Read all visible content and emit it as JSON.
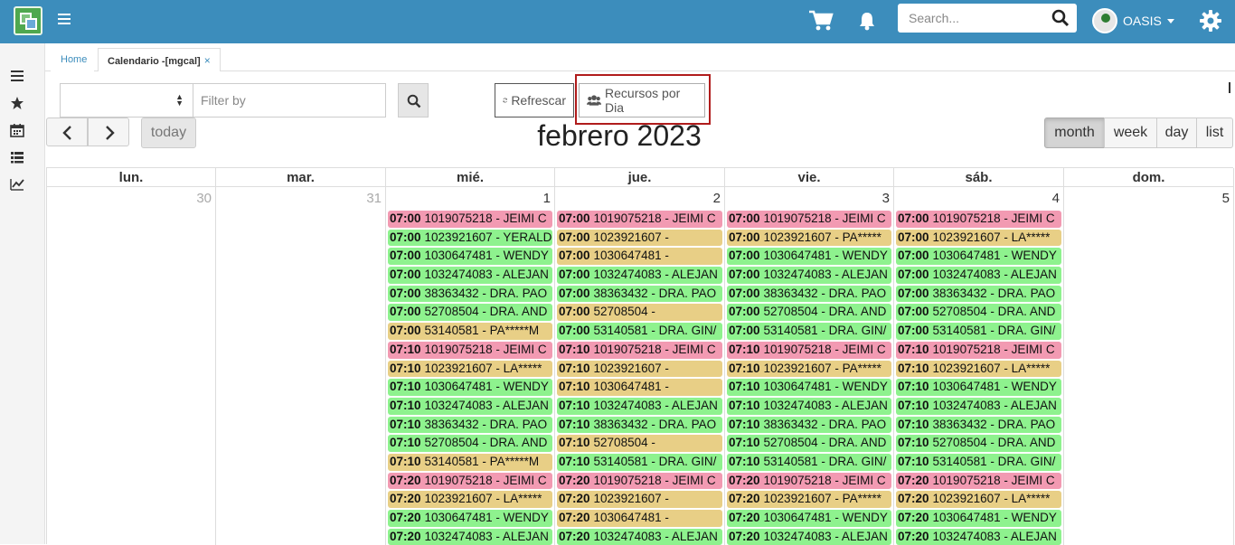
{
  "header": {
    "search_placeholder": "Search...",
    "user_name": "OASIS"
  },
  "tabs": [
    {
      "label": "Home"
    },
    {
      "label": "Calendario -[mgcal]",
      "close": "×"
    }
  ],
  "toolbar": {
    "filter_placeholder": "Filter by",
    "refresh_label": "Refrescar",
    "recursos_label": "Recursos por Dia"
  },
  "calendar": {
    "title": "febrero 2023",
    "today_label": "today",
    "views": [
      "month",
      "week",
      "day",
      "list"
    ],
    "active_view": "month",
    "weekdays": [
      "lun.",
      "mar.",
      "mié.",
      "jue.",
      "vie.",
      "sáb.",
      "dom."
    ],
    "day_numbers": [
      "30",
      "31",
      "1",
      "2",
      "3",
      "4",
      "5"
    ],
    "columns": [
      {
        "events": []
      },
      {
        "events": []
      },
      {
        "events": [
          {
            "time": "07:00",
            "text": "1019075218 - JEIMI C",
            "color": "pink"
          },
          {
            "time": "07:00",
            "text": "1023921607 - YERALD",
            "color": "green"
          },
          {
            "time": "07:00",
            "text": "1030647481 - WENDY",
            "color": "green"
          },
          {
            "time": "07:00",
            "text": "1032474083 - ALEJAN",
            "color": "green"
          },
          {
            "time": "07:00",
            "text": "38363432 - DRA. PAO",
            "color": "green"
          },
          {
            "time": "07:00",
            "text": "52708504 - DRA. AND",
            "color": "green"
          },
          {
            "time": "07:00",
            "text": "53140581 - PA*****M",
            "color": "yellow"
          },
          {
            "time": "07:10",
            "text": "1019075218 - JEIMI C",
            "color": "pink"
          },
          {
            "time": "07:10",
            "text": "1023921607 - LA*****",
            "color": "yellow"
          },
          {
            "time": "07:10",
            "text": "1030647481 - WENDY",
            "color": "green"
          },
          {
            "time": "07:10",
            "text": "1032474083 - ALEJAN",
            "color": "green"
          },
          {
            "time": "07:10",
            "text": "38363432 - DRA. PAO",
            "color": "green"
          },
          {
            "time": "07:10",
            "text": "52708504 - DRA. AND",
            "color": "green"
          },
          {
            "time": "07:10",
            "text": "53140581 - PA*****M",
            "color": "yellow"
          },
          {
            "time": "07:20",
            "text": "1019075218 - JEIMI C",
            "color": "pink"
          },
          {
            "time": "07:20",
            "text": "1023921607 - LA*****",
            "color": "yellow"
          },
          {
            "time": "07:20",
            "text": "1030647481 - WENDY",
            "color": "green"
          },
          {
            "time": "07:20",
            "text": "1032474083 - ALEJAN",
            "color": "green"
          }
        ]
      },
      {
        "events": [
          {
            "time": "07:00",
            "text": "1019075218 - JEIMI C",
            "color": "pink"
          },
          {
            "time": "07:00",
            "text": "1023921607 -",
            "color": "yellow"
          },
          {
            "time": "07:00",
            "text": "1030647481 -",
            "color": "yellow"
          },
          {
            "time": "07:00",
            "text": "1032474083 - ALEJAN",
            "color": "green"
          },
          {
            "time": "07:00",
            "text": "38363432 - DRA. PAO",
            "color": "green"
          },
          {
            "time": "07:00",
            "text": "52708504 -",
            "color": "yellow"
          },
          {
            "time": "07:00",
            "text": "53140581 - DRA. GIN/",
            "color": "green"
          },
          {
            "time": "07:10",
            "text": "1019075218 - JEIMI C",
            "color": "pink"
          },
          {
            "time": "07:10",
            "text": "1023921607 -",
            "color": "yellow"
          },
          {
            "time": "07:10",
            "text": "1030647481 -",
            "color": "yellow"
          },
          {
            "time": "07:10",
            "text": "1032474083 - ALEJAN",
            "color": "green"
          },
          {
            "time": "07:10",
            "text": "38363432 - DRA. PAO",
            "color": "green"
          },
          {
            "time": "07:10",
            "text": "52708504 -",
            "color": "yellow"
          },
          {
            "time": "07:10",
            "text": "53140581 - DRA. GIN/",
            "color": "green"
          },
          {
            "time": "07:20",
            "text": "1019075218 - JEIMI C",
            "color": "pink"
          },
          {
            "time": "07:20",
            "text": "1023921607 -",
            "color": "yellow"
          },
          {
            "time": "07:20",
            "text": "1030647481 -",
            "color": "yellow"
          },
          {
            "time": "07:20",
            "text": "1032474083 - ALEJAN",
            "color": "green"
          }
        ]
      },
      {
        "events": [
          {
            "time": "07:00",
            "text": "1019075218 - JEIMI C",
            "color": "pink"
          },
          {
            "time": "07:00",
            "text": "1023921607 - PA*****",
            "color": "yellow"
          },
          {
            "time": "07:00",
            "text": "1030647481 - WENDY",
            "color": "green"
          },
          {
            "time": "07:00",
            "text": "1032474083 - ALEJAN",
            "color": "green"
          },
          {
            "time": "07:00",
            "text": "38363432 - DRA. PAO",
            "color": "green"
          },
          {
            "time": "07:00",
            "text": "52708504 - DRA. AND",
            "color": "green"
          },
          {
            "time": "07:00",
            "text": "53140581 - DRA. GIN/",
            "color": "green"
          },
          {
            "time": "07:10",
            "text": "1019075218 - JEIMI C",
            "color": "pink"
          },
          {
            "time": "07:10",
            "text": "1023921607 - PA*****",
            "color": "yellow"
          },
          {
            "time": "07:10",
            "text": "1030647481 - WENDY",
            "color": "green"
          },
          {
            "time": "07:10",
            "text": "1032474083 - ALEJAN",
            "color": "green"
          },
          {
            "time": "07:10",
            "text": "38363432 - DRA. PAO",
            "color": "green"
          },
          {
            "time": "07:10",
            "text": "52708504 - DRA. AND",
            "color": "green"
          },
          {
            "time": "07:10",
            "text": "53140581 - DRA. GIN/",
            "color": "green"
          },
          {
            "time": "07:20",
            "text": "1019075218 - JEIMI C",
            "color": "pink"
          },
          {
            "time": "07:20",
            "text": "1023921607 - PA*****",
            "color": "yellow"
          },
          {
            "time": "07:20",
            "text": "1030647481 - WENDY",
            "color": "green"
          },
          {
            "time": "07:20",
            "text": "1032474083 - ALEJAN",
            "color": "green"
          }
        ]
      },
      {
        "events": [
          {
            "time": "07:00",
            "text": "1019075218 - JEIMI C",
            "color": "pink"
          },
          {
            "time": "07:00",
            "text": "1023921607 - LA*****",
            "color": "yellow"
          },
          {
            "time": "07:00",
            "text": "1030647481 - WENDY",
            "color": "green"
          },
          {
            "time": "07:00",
            "text": "1032474083 - ALEJAN",
            "color": "green"
          },
          {
            "time": "07:00",
            "text": "38363432 - DRA. PAO",
            "color": "green"
          },
          {
            "time": "07:00",
            "text": "52708504 - DRA. AND",
            "color": "green"
          },
          {
            "time": "07:00",
            "text": "53140581 - DRA. GIN/",
            "color": "green"
          },
          {
            "time": "07:10",
            "text": "1019075218 - JEIMI C",
            "color": "pink"
          },
          {
            "time": "07:10",
            "text": "1023921607 - LA*****",
            "color": "yellow"
          },
          {
            "time": "07:10",
            "text": "1030647481 - WENDY",
            "color": "green"
          },
          {
            "time": "07:10",
            "text": "1032474083 - ALEJAN",
            "color": "green"
          },
          {
            "time": "07:10",
            "text": "38363432 - DRA. PAO",
            "color": "green"
          },
          {
            "time": "07:10",
            "text": "52708504 - DRA. AND",
            "color": "green"
          },
          {
            "time": "07:10",
            "text": "53140581 - DRA. GIN/",
            "color": "green"
          },
          {
            "time": "07:20",
            "text": "1019075218 - JEIMI C",
            "color": "pink"
          },
          {
            "time": "07:20",
            "text": "1023921607 - LA*****",
            "color": "yellow"
          },
          {
            "time": "07:20",
            "text": "1030647481 - WENDY",
            "color": "green"
          },
          {
            "time": "07:20",
            "text": "1032474083 - ALEJAN",
            "color": "green"
          }
        ]
      },
      {
        "events": []
      }
    ]
  },
  "colors": {
    "topbar": "#3c8dbc",
    "event_pink": "#f29ab2",
    "event_green": "#8ef28e",
    "event_yellow": "#e8cf86",
    "highlight_border": "#b01c1c"
  },
  "icons": {
    "logo": "app-logo-icon",
    "menu": "hamburger-icon",
    "cart": "cart-icon",
    "bell": "bell-icon",
    "search": "search-icon",
    "settings": "gear-icon",
    "refresh": "refresh-icon",
    "users": "users-icon",
    "rail": [
      "list-icon",
      "star-icon",
      "calendar-icon",
      "table-icon",
      "chart-icon"
    ]
  }
}
